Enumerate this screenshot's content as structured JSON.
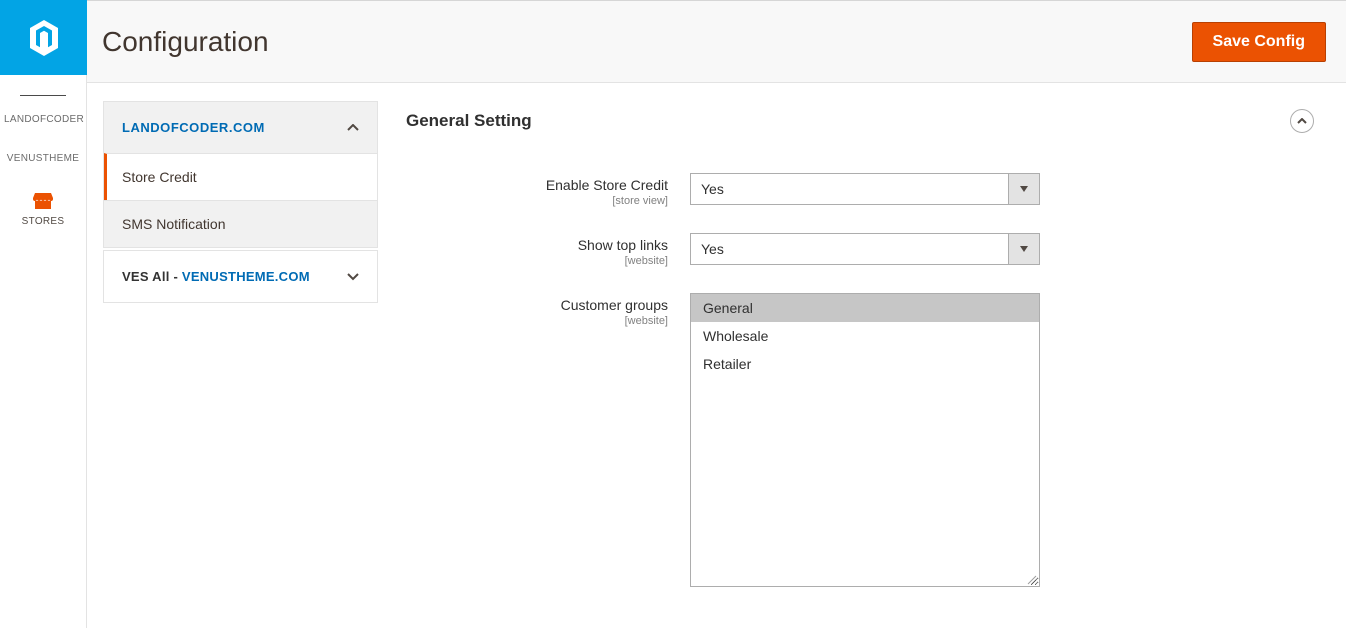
{
  "header": {
    "title": "Configuration",
    "save_label": "Save Config"
  },
  "sidebar": {
    "items": [
      {
        "label": "LANDOFCODER"
      },
      {
        "label": "VENUSTHEME"
      },
      {
        "label": "STORES"
      }
    ]
  },
  "tabs": {
    "group1": {
      "title": "LANDOFCODER.COM",
      "items": [
        {
          "label": "Store Credit"
        },
        {
          "label": "SMS Notification"
        }
      ]
    },
    "group2": {
      "title_prefix": "VES All - ",
      "title_link": "VENUSTHEME.COM"
    }
  },
  "section": {
    "title": "General Setting"
  },
  "fields": {
    "enable": {
      "label": "Enable Store Credit",
      "scope": "[store view]",
      "value": "Yes"
    },
    "toplinks": {
      "label": "Show top links",
      "scope": "[website]",
      "value": "Yes"
    },
    "groups": {
      "label": "Customer groups",
      "scope": "[website]",
      "options": [
        {
          "label": "General",
          "selected": true
        },
        {
          "label": "Wholesale",
          "selected": false
        },
        {
          "label": "Retailer",
          "selected": false
        }
      ]
    }
  }
}
